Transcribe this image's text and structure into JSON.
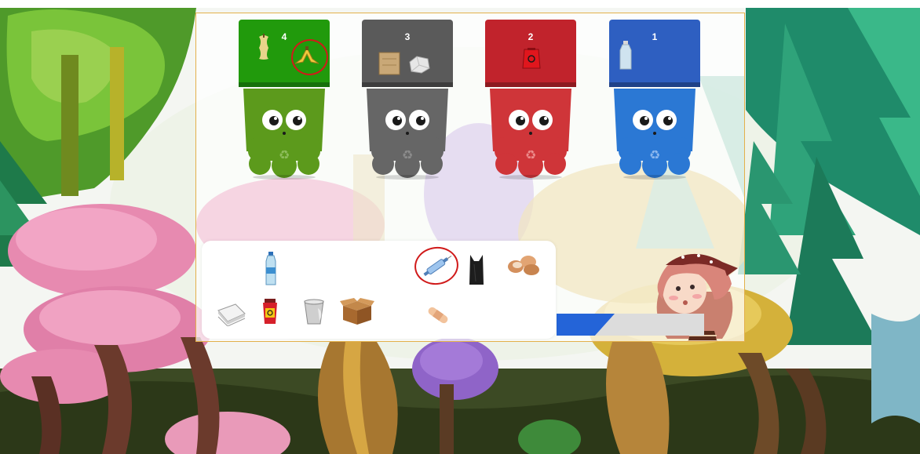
{
  "game": {
    "bins": [
      {
        "count": "4",
        "color": "#219a0c",
        "body_color": "#5c9a1c",
        "items": [
          "apple-core-icon",
          "banana-peel-icon"
        ]
      },
      {
        "count": "3",
        "color": "#5a5a5a",
        "body_color": "#666666",
        "items": [
          "cardboard-icon",
          "crumpled-paper-icon"
        ]
      },
      {
        "count": "2",
        "color": "#c1232c",
        "body_color": "#cf3539",
        "items": [
          "biohazard-bag-icon"
        ]
      },
      {
        "count": "1",
        "color": "#2e5fc1",
        "body_color": "#2b78d4",
        "items": [
          "water-bottle-icon"
        ]
      }
    ],
    "tray_items": [
      "water-bottle-icon",
      "syringe-icon",
      "black-trash-bag-icon",
      "eggshells-icon",
      "paper-stack-icon",
      "biohazard-container-icon",
      "plastic-cup-icon",
      "cardboard-box-icon",
      "bandage-icon"
    ],
    "progress": 0.35,
    "colors": {
      "board_border": "#e3b04b",
      "annotation": "#d01a1a",
      "progress_fill": "#2464d8"
    }
  }
}
